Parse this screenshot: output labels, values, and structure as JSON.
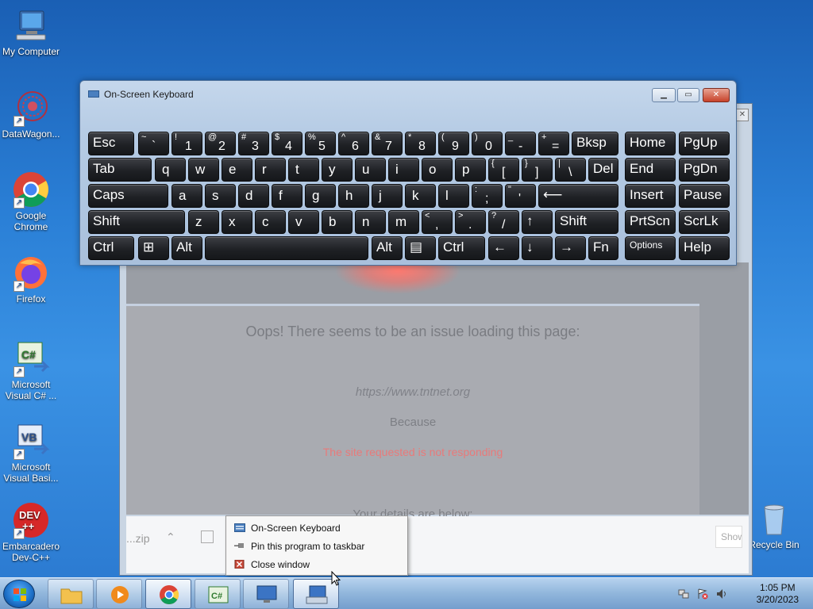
{
  "desktop": {
    "icons": [
      {
        "label": "My Computer"
      },
      {
        "label": "DataWagon..."
      },
      {
        "label": "Google Chrome"
      },
      {
        "label": "Firefox"
      },
      {
        "label": "Microsoft Visual C# ..."
      },
      {
        "label": "Microsoft Visual Basi..."
      },
      {
        "label": "Embarcadero Dev-C++"
      },
      {
        "label": "Recycle Bin"
      }
    ]
  },
  "browser": {
    "error_title": "Oops! There seems to be an issue loading this page:",
    "url": "https://www.tntnet.org",
    "because": "Because",
    "reason": "The site requested is not responding",
    "details": "Your details are below:",
    "download_file": "...zip",
    "show_all": "Show all"
  },
  "osk": {
    "title": "On-Screen Keyboard",
    "colors": {
      "key_bg": "#1f2125",
      "key_text": "#ffffff",
      "frame": "#b5cbe4"
    },
    "rows": [
      [
        {
          "label": "Esc"
        },
        {
          "shift": "~",
          "base": "`"
        },
        {
          "shift": "!",
          "base": "1"
        },
        {
          "shift": "@",
          "base": "2"
        },
        {
          "shift": "#",
          "base": "3"
        },
        {
          "shift": "$",
          "base": "4"
        },
        {
          "shift": "%",
          "base": "5"
        },
        {
          "shift": "^",
          "base": "6"
        },
        {
          "shift": "&",
          "base": "7"
        },
        {
          "shift": "*",
          "base": "8"
        },
        {
          "shift": "(",
          "base": "9"
        },
        {
          "shift": ")",
          "base": "0"
        },
        {
          "shift": "_",
          "base": "-"
        },
        {
          "shift": "+",
          "base": "="
        },
        {
          "label": "Bksp"
        },
        {
          "label": "Home"
        },
        {
          "label": "PgUp"
        }
      ],
      [
        {
          "label": "Tab"
        },
        {
          "label": "q"
        },
        {
          "label": "w"
        },
        {
          "label": "e"
        },
        {
          "label": "r"
        },
        {
          "label": "t"
        },
        {
          "label": "y"
        },
        {
          "label": "u"
        },
        {
          "label": "i"
        },
        {
          "label": "o"
        },
        {
          "label": "p"
        },
        {
          "shift": "{",
          "base": "["
        },
        {
          "shift": "}",
          "base": "]"
        },
        {
          "shift": "|",
          "base": "\\"
        },
        {
          "label": "Del"
        },
        {
          "label": "End"
        },
        {
          "label": "PgDn"
        }
      ],
      [
        {
          "label": "Caps"
        },
        {
          "label": "a"
        },
        {
          "label": "s"
        },
        {
          "label": "d"
        },
        {
          "label": "f"
        },
        {
          "label": "g"
        },
        {
          "label": "h"
        },
        {
          "label": "j"
        },
        {
          "label": "k"
        },
        {
          "label": "l"
        },
        {
          "shift": ":",
          "base": ";"
        },
        {
          "shift": "\"",
          "base": "'"
        },
        {
          "label": "⟵"
        },
        {
          "label": "Insert"
        },
        {
          "label": "Pause"
        }
      ],
      [
        {
          "label": "Shift"
        },
        {
          "label": "z"
        },
        {
          "label": "x"
        },
        {
          "label": "c"
        },
        {
          "label": "v"
        },
        {
          "label": "b"
        },
        {
          "label": "n"
        },
        {
          "label": "m"
        },
        {
          "shift": "<",
          "base": ","
        },
        {
          "shift": ">",
          "base": "."
        },
        {
          "shift": "?",
          "base": "/"
        },
        {
          "label": "↑"
        },
        {
          "label": "Shift"
        },
        {
          "label": "PrtScn"
        },
        {
          "label": "ScrLk"
        }
      ],
      [
        {
          "label": "Ctrl"
        },
        {
          "label": "⊞"
        },
        {
          "label": "Alt"
        },
        {
          "label": ""
        },
        {
          "label": "Alt"
        },
        {
          "label": "▤"
        },
        {
          "label": "Ctrl"
        },
        {
          "label": "←"
        },
        {
          "label": "↓"
        },
        {
          "label": "→"
        },
        {
          "label": "Fn"
        },
        {
          "label": "Options"
        },
        {
          "label": "Help"
        }
      ]
    ]
  },
  "context_menu": {
    "items": [
      {
        "label": "On-Screen Keyboard"
      },
      {
        "label": "Pin this program to taskbar"
      },
      {
        "label": "Close window"
      }
    ]
  },
  "taskbar": {
    "time": "1:05 PM",
    "date": "3/20/2023"
  }
}
